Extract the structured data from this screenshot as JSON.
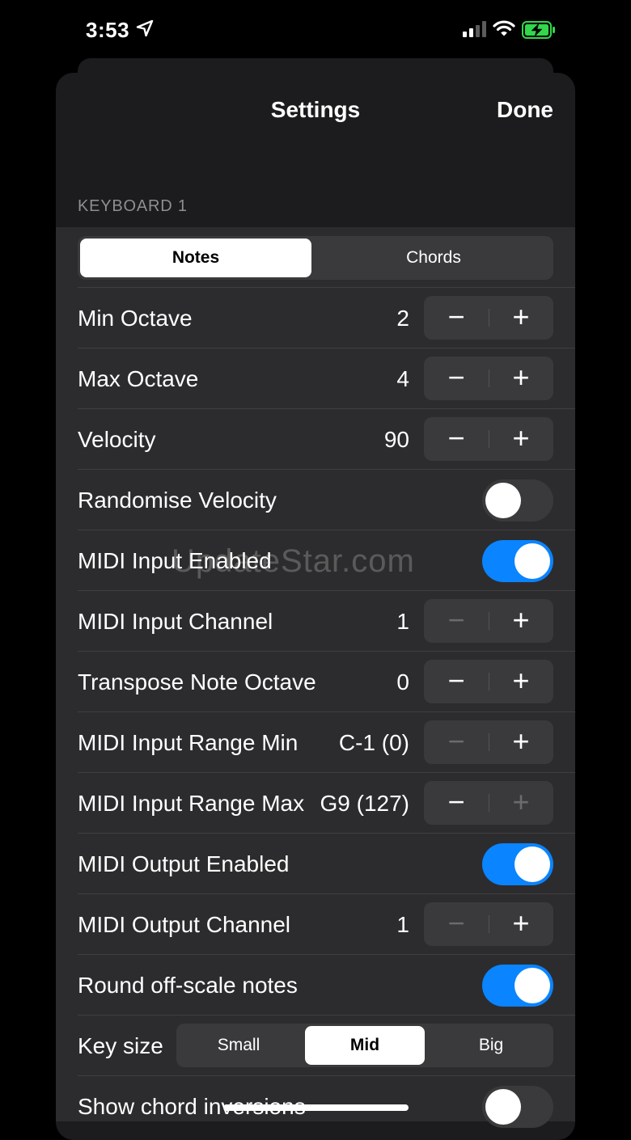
{
  "status": {
    "time": "3:53"
  },
  "nav": {
    "title": "Settings",
    "done": "Done"
  },
  "section": {
    "header": "KEYBOARD 1"
  },
  "mode_tabs": {
    "notes": "Notes",
    "chords": "Chords",
    "selected": "Notes"
  },
  "rows": {
    "min_octave": {
      "label": "Min Octave",
      "value": "2"
    },
    "max_octave": {
      "label": "Max Octave",
      "value": "4"
    },
    "velocity": {
      "label": "Velocity",
      "value": "90"
    },
    "randomise_velocity": {
      "label": "Randomise Velocity",
      "on": false
    },
    "midi_input_enabled": {
      "label": "MIDI Input Enabled",
      "on": true
    },
    "midi_input_channel": {
      "label": "MIDI Input Channel",
      "value": "1"
    },
    "transpose_note_octave": {
      "label": "Transpose Note Octave",
      "value": "0"
    },
    "midi_input_range_min": {
      "label": "MIDI Input Range Min",
      "value": "C-1 (0)"
    },
    "midi_input_range_max": {
      "label": "MIDI Input Range Max",
      "value": "G9 (127)"
    },
    "midi_output_enabled": {
      "label": "MIDI Output Enabled",
      "on": true
    },
    "midi_output_channel": {
      "label": "MIDI Output Channel",
      "value": "1"
    },
    "round_off_scale": {
      "label": "Round off-scale notes",
      "on": true
    },
    "key_size": {
      "label": "Key size",
      "options": [
        "Small",
        "Mid",
        "Big"
      ],
      "selected": "Mid"
    },
    "show_chord_inversions": {
      "label": "Show chord inversions",
      "on": false
    }
  },
  "stepper": {
    "minus": "−",
    "plus": "+"
  },
  "watermark": "UpdateStar.com",
  "colors": {
    "accent": "#0a84ff",
    "background": "#000000",
    "sheet": "#1c1c1e",
    "cell": "#2c2c2e"
  }
}
